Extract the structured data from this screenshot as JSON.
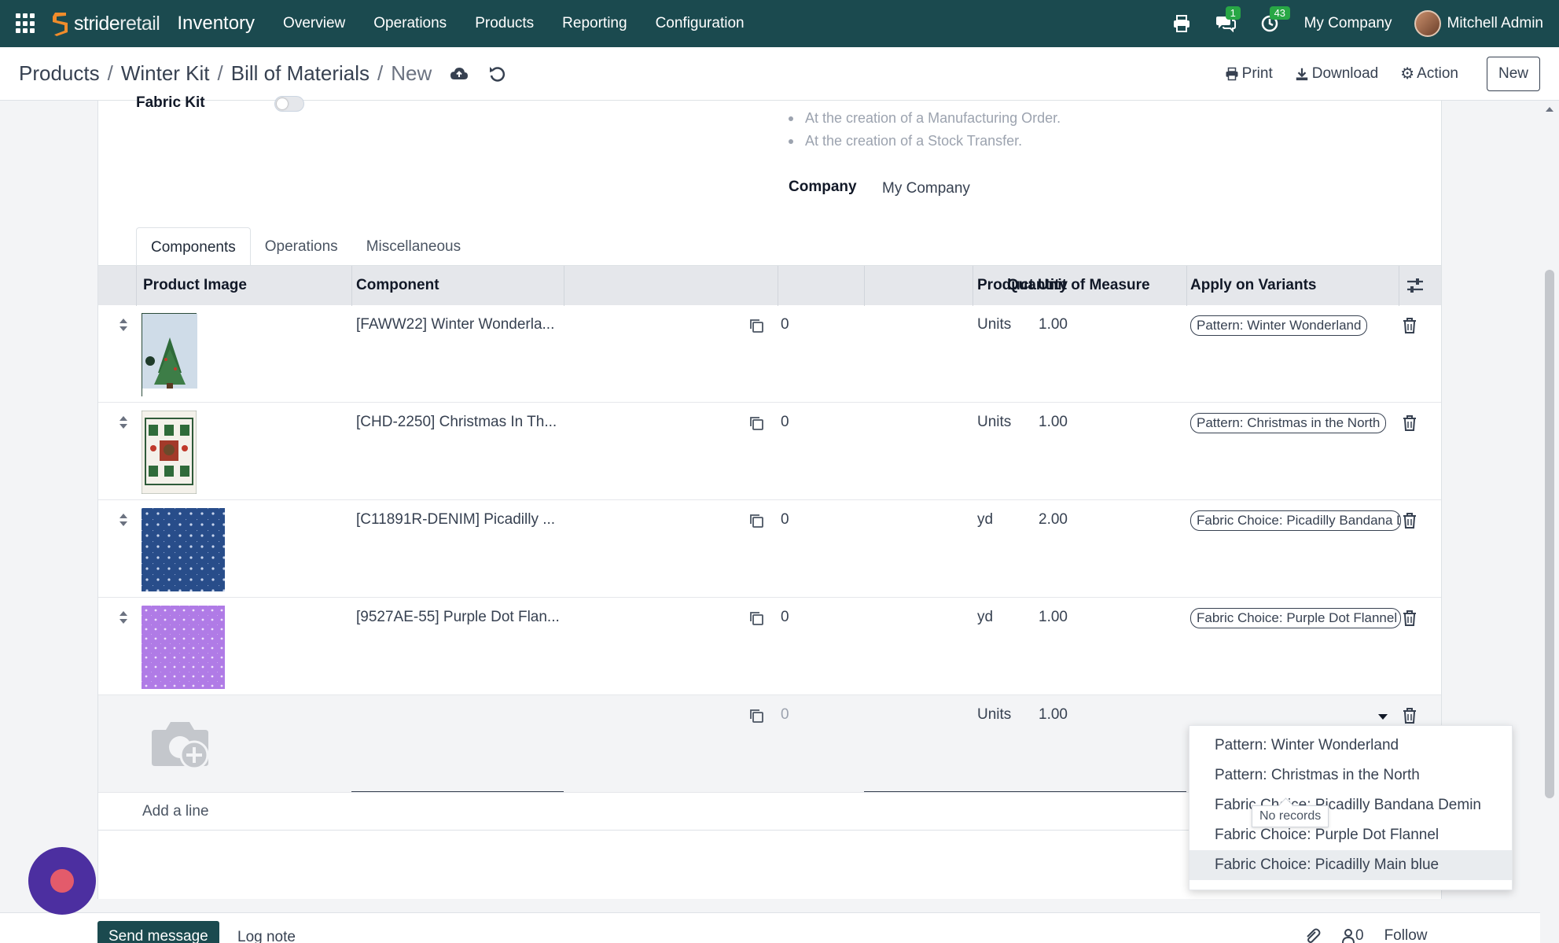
{
  "navbar": {
    "brand_prefix": "stride",
    "brand_suffix": "retail",
    "app_name": "Inventory",
    "menu": [
      "Overview",
      "Operations",
      "Products",
      "Reporting",
      "Configuration"
    ],
    "messages_badge": "1",
    "activities_badge": "43",
    "company": "My Company",
    "user": "Mitchell Admin"
  },
  "control": {
    "breadcrumb": [
      "Products",
      "Winter Kit",
      "Bill of Materials"
    ],
    "current": "New",
    "print_label": "Print",
    "download_label": "Download",
    "action_label": "Action",
    "new_label": "New"
  },
  "form": {
    "fabric_kit_label": "Fabric Kit",
    "bullets": [
      "At the creation of a Manufacturing Order.",
      "At the creation of a Stock Transfer."
    ],
    "company_label": "Company",
    "company_value": "My Company"
  },
  "tabs": [
    "Components",
    "Operations",
    "Miscellaneous"
  ],
  "table": {
    "headers": {
      "image": "Product Image",
      "component": "Component",
      "quantity": "Quantity",
      "uom": "Product Unit of Measure",
      "variants": "Apply on Variants"
    },
    "rows": [
      {
        "component": "[FAWW22] Winter Wonderla...",
        "zero": "0",
        "quantity": "1.00",
        "uom": "Units",
        "variant": "Pattern: Winter Wonderland"
      },
      {
        "component": "[CHD-2250] Christmas In Th...",
        "zero": "0",
        "quantity": "1.00",
        "uom": "Units",
        "variant": "Pattern: Christmas in the North"
      },
      {
        "component": "[C11891R-DENIM] Picadilly ...",
        "zero": "0",
        "quantity": "2.00",
        "uom": "yd",
        "variant": "Fabric Choice: Picadilly Bandana Demin"
      },
      {
        "component": "[9527AE-55] Purple Dot Flan...",
        "zero": "0",
        "quantity": "1.00",
        "uom": "yd",
        "variant": "Fabric Choice: Purple Dot Flannel"
      }
    ],
    "new_row": {
      "zero": "0",
      "quantity": "1.00",
      "uom": "Units"
    },
    "add_line": "Add a line"
  },
  "dropdown": {
    "options": [
      "Pattern: Winter Wonderland",
      "Pattern: Christmas in the North",
      "Fabric Choice: Picadilly Bandana Demin",
      "Fabric Choice: Purple Dot Flannel",
      "Fabric Choice: Picadilly Main blue"
    ],
    "tooltip": "No records"
  },
  "chatter": {
    "send_label": "Send message",
    "log_label": "Log note",
    "followers": "0",
    "follow_label": "Follow"
  }
}
